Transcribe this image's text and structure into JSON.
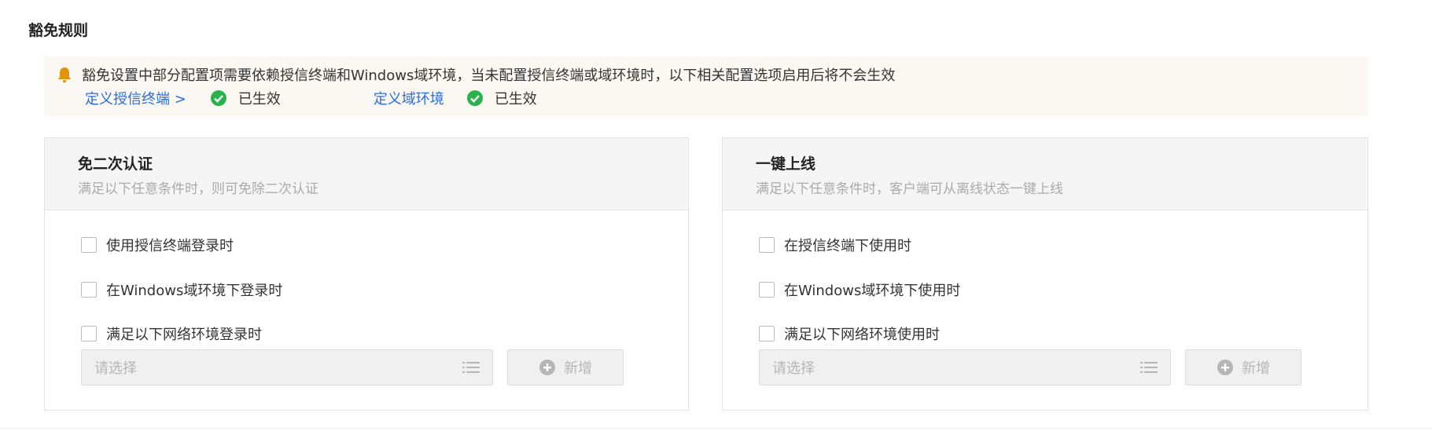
{
  "page_title": "豁免规则",
  "notice": {
    "text": "豁免设置中部分配置项需要依赖授信终端和Windows域环境，当未配置授信终端或域环境时，以下相关配置选项启用后将不会生效",
    "items": [
      {
        "link": "定义授信终端 >",
        "status": "已生效"
      },
      {
        "link": "定义域环境",
        "status": "已生效"
      }
    ]
  },
  "cards": [
    {
      "title": "免二次认证",
      "desc": "满足以下任意条件时，则可免除二次认证",
      "options": [
        "使用授信终端登录时",
        "在Windows域环境下登录时",
        "满足以下网络环境登录时"
      ],
      "select_placeholder": "请选择",
      "add_label": "新增"
    },
    {
      "title": "一键上线",
      "desc": "满足以下任意条件时，客户端可从离线状态一键上线",
      "options": [
        "在授信终端下使用时",
        "在Windows域环境下使用时",
        "满足以下网络环境使用时"
      ],
      "select_placeholder": "请选择",
      "add_label": "新增"
    }
  ],
  "colors": {
    "link": "#2a6ce0",
    "success": "#2bb24c",
    "bell": "#e0930d",
    "notice_bg": "#fbf8f3"
  }
}
